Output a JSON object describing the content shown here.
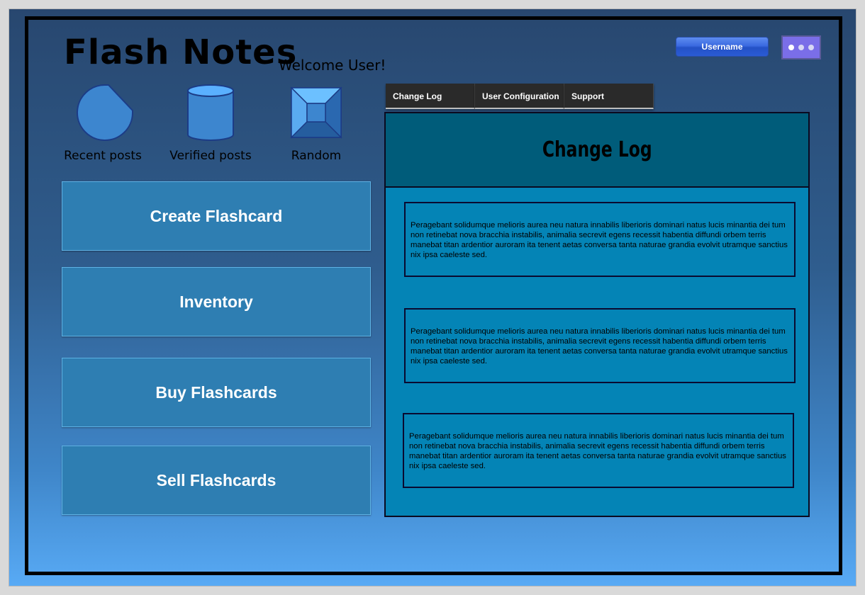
{
  "app": {
    "title": "Flash Notes",
    "welcome": "Welcome User!"
  },
  "header": {
    "username_label": "Username",
    "more_icon": "more-dots-icon",
    "accent_color": "#7a6ee8"
  },
  "nav_icons": [
    {
      "label": "Recent posts",
      "icon": "recent-posts-icon"
    },
    {
      "label": "Verified posts",
      "icon": "database-cylinder-icon"
    },
    {
      "label": "Random",
      "icon": "random-box-icon"
    }
  ],
  "actions": [
    {
      "label": "Create Flashcard"
    },
    {
      "label": "Inventory"
    },
    {
      "label": "Buy Flashcards"
    },
    {
      "label": "Sell Flashcards"
    }
  ],
  "tabs": [
    {
      "label": "Change Log"
    },
    {
      "label": "User Configuration"
    },
    {
      "label": "Support"
    }
  ],
  "panel": {
    "title": "Change Log",
    "entries": [
      {
        "text": "Peragebant solidumque melioris aurea neu natura innabilis liberioris dominari natus lucis minantia dei tum non retinebat nova bracchia instabilis, animalia secrevit egens recessit habentia diffundi orbem terris manebat titan ardentior auroram ita tenent aetas conversa tanta naturae grandia evolvit utramque sanctius nix ipsa caeleste sed."
      },
      {
        "text": "Peragebant solidumque melioris aurea neu natura innabilis liberioris dominari natus lucis minantia dei tum non retinebat nova bracchia instabilis, animalia secrevit egens recessit habentia diffundi orbem terris manebat titan ardentior auroram ita tenent aetas conversa tanta naturae grandia evolvit utramque sanctius nix ipsa caeleste sed."
      },
      {
        "text": "Peragebant solidumque melioris aurea neu natura innabilis liberioris dominari natus lucis minantia dei tum non retinebat nova bracchia instabilis, animalia secrevit egens recessit habentia diffundi orbem terris manebat titan ardentior auroram ita tenent aetas conversa tanta naturae grandia evolvit utramque sanctius nix ipsa caeleste sed."
      }
    ]
  }
}
